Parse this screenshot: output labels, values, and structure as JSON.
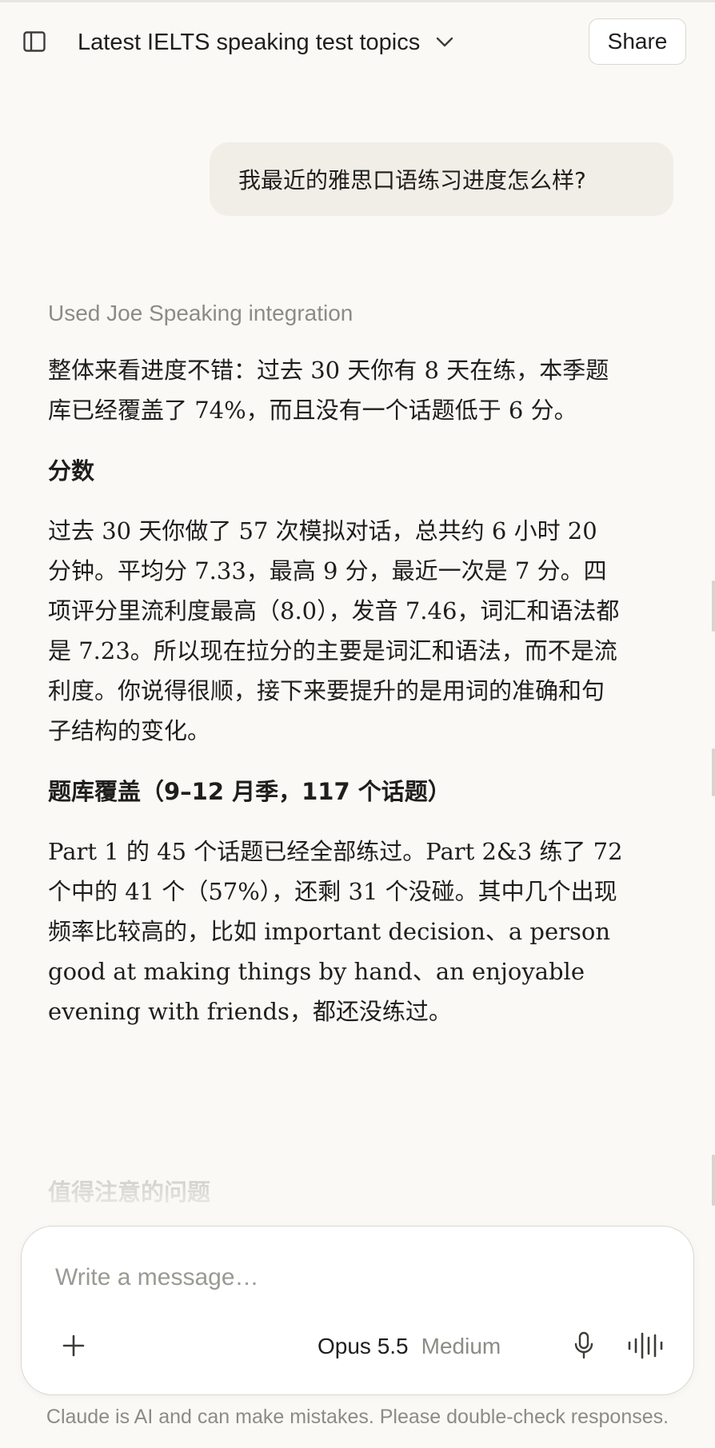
{
  "header": {
    "title": "Latest IELTS speaking test topics",
    "share_label": "Share"
  },
  "user_message": "我最近的雅思口语练习进度怎么样?",
  "response": {
    "tool_status": "Used Joe Speaking integration",
    "intro": "整体来看进度不错：过去 30 天你有 8 天在练，本季题库已经覆盖了 74%，而且没有一个话题低于 6 分。",
    "section_scores": {
      "heading": "分数",
      "body": "过去 30 天你做了 57 次模拟对话，总共约 6 小时 20 分钟。平均分 7.33，最高 9 分，最近一次是 7 分。四项评分里流利度最高（8.0），发音 7.46，词汇和语法都是 7.23。所以现在拉分的主要是词汇和语法，而不是流利度。你说得很顺，接下来要提升的是用词的准确和句子结构的变化。"
    },
    "section_coverage": {
      "heading": "题库覆盖（9–12 月季，117 个话题）",
      "body": "Part 1 的 45 个话题已经全部练过。Part 2&3 练了 72 个中的 41 个（57%），还剩 31 个没碰。其中几个出现频率比较高的，比如 important decision、a person good at making things by hand、an enjoyable evening with friends，都还没练过。"
    },
    "next_heading": "值得注意的问题"
  },
  "composer": {
    "placeholder": "Write a message…",
    "model_name": "Opus 5.5",
    "model_effort": "Medium"
  },
  "footer": {
    "disclaimer": "Claude is AI and can make mistakes. Please double-check responses."
  },
  "icons": {
    "sidebar": "sidebar-toggle-icon",
    "chevron": "chevron-down-icon",
    "add": "plus-icon",
    "mic": "microphone-icon",
    "voice": "voice-waveform-icon"
  }
}
